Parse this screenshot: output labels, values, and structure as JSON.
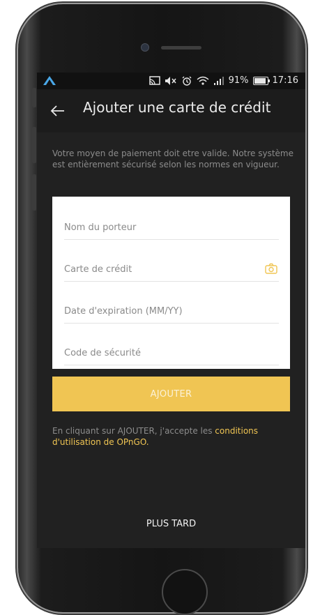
{
  "status_bar": {
    "battery_percent": "91%",
    "battery_level": 0.91,
    "time": "17:16",
    "icons": [
      "app-logo-icon",
      "cast-icon",
      "mute-icon",
      "alarm-icon",
      "wifi-icon",
      "signal-icon",
      "battery-icon"
    ]
  },
  "header": {
    "back_icon": "arrow-left-icon",
    "title": "Ajouter une carte de crédit"
  },
  "description": "Votre moyen de paiement doit etre valide. Notre système est entièrement sécurisé selon les normes en vigueur.",
  "form": {
    "cardholder_placeholder": "Nom du porteur",
    "card_number_placeholder": "Carte de crédit",
    "expiry_placeholder": "Date d'expiration (MM/YY)",
    "security_code_placeholder": "Code de sécurité",
    "scan_icon": "camera-icon"
  },
  "submit_label": "AJOUTER",
  "terms": {
    "prefix": "En cliquant sur AJOUTER, j'accepte les ",
    "link": "conditions d'utilisation de OPnGO."
  },
  "later_label": "PLUS TARD",
  "colors": {
    "background": "#212121",
    "accent": "#f0c553",
    "muted_text": "#8c8c8c"
  }
}
